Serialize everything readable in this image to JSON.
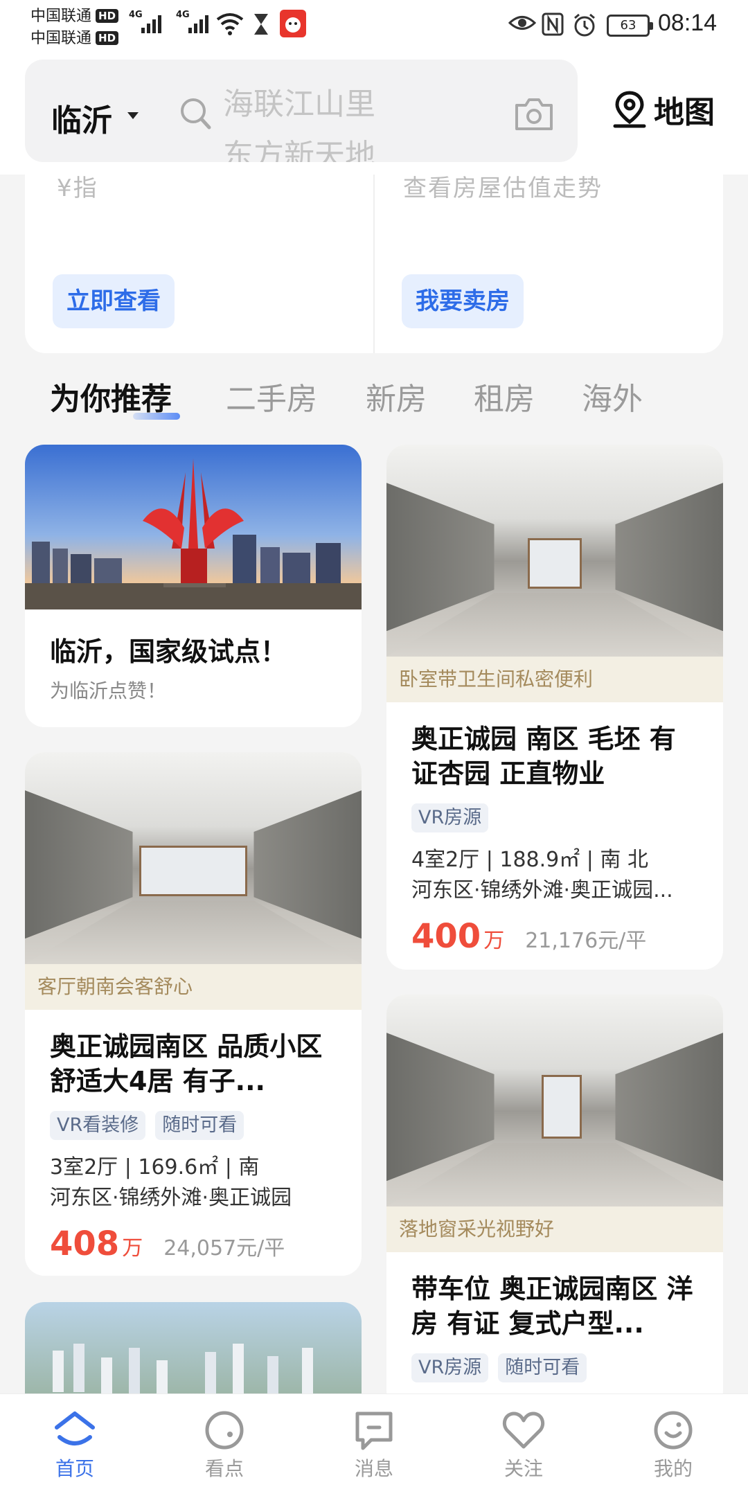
{
  "status_bar": {
    "carrier_1": "中国联通",
    "carrier_2": "中国联通",
    "hd": "HD",
    "network": "4G",
    "battery": "63",
    "time": "08:14"
  },
  "header": {
    "city": "临沂",
    "search_suggestions": [
      "海联江山里",
      "东方新天地"
    ],
    "map_label": "地图"
  },
  "top_cards": {
    "left_cut_text": "¥指",
    "right_cut_text": "查看房屋估值走势",
    "left_button": "立即查看",
    "right_button": "我要卖房"
  },
  "tabs": [
    "为你推荐",
    "二手房",
    "新房",
    "租房",
    "海外"
  ],
  "feed": {
    "promo": {
      "title": "临沂，国家级试点！",
      "subtitle": "为临沂点赞！"
    },
    "listing_1": {
      "tagline": "卧室带卫生间私密便利",
      "title": "奥正诚园 南区 毛坯 有证杏园 正直物业",
      "tags": [
        "VR房源"
      ],
      "spec": "4室2厅 | 188.9㎡ | 南 北",
      "address": "河东区·锦绣外滩·奥正诚园...",
      "price": "400",
      "price_unit": "万",
      "unit_price": "21,176元/平"
    },
    "listing_2": {
      "tagline": "客厅朝南会客舒心",
      "title": "奥正诚园南区 品质小区 舒适大4居 有子...",
      "tags": [
        "VR看装修",
        "随时可看"
      ],
      "spec": "3室2厅 | 169.6㎡ | 南",
      "address": "河东区·锦绣外滩·奥正诚园",
      "price": "408",
      "price_unit": "万",
      "unit_price": "24,057元/平"
    },
    "listing_3": {
      "tagline": "落地窗采光视野好",
      "title": "带车位 奥正诚园南区 洋房 有证 复式户型...",
      "tags": [
        "VR房源",
        "随时可看"
      ]
    }
  },
  "bottom_nav": [
    "首页",
    "看点",
    "消息",
    "关注",
    "我的"
  ],
  "colors": {
    "accent": "#3b72e8",
    "price": "#ef4d3b",
    "tagline_bg": "#f3efe3",
    "tagline_text": "#a48a5c"
  }
}
